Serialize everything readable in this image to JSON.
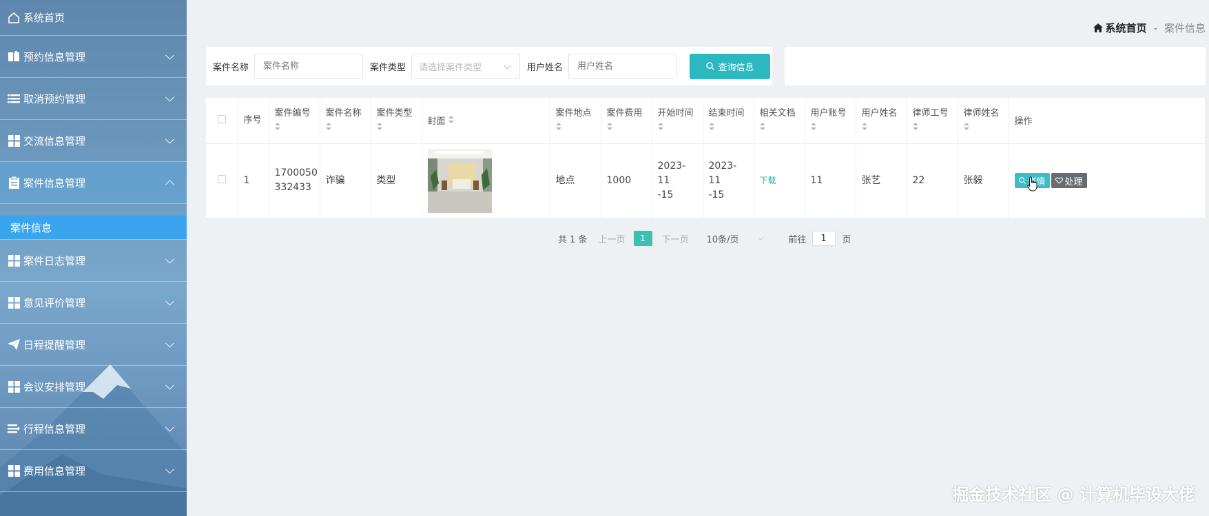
{
  "sidebar": {
    "home": "系统首页",
    "items": [
      {
        "label": "预约信息管理",
        "icon": "book-icon"
      },
      {
        "label": "取消预约管理",
        "icon": "list-icon"
      },
      {
        "label": "交流信息管理",
        "icon": "grid-icon"
      },
      {
        "label": "案件信息管理",
        "icon": "clipboard-icon",
        "expanded": true
      },
      {
        "label": "案件日志管理",
        "icon": "grid-icon"
      },
      {
        "label": "意见评价管理",
        "icon": "grid-icon"
      },
      {
        "label": "日程提醒管理",
        "icon": "paper-plane-icon"
      },
      {
        "label": "会议安排管理",
        "icon": "grid-icon"
      },
      {
        "label": "行程信息管理",
        "icon": "list-arrow-icon"
      },
      {
        "label": "费用信息管理",
        "icon": "grid-icon"
      }
    ],
    "submenu": {
      "label": "案件信息"
    },
    "accent_color": "#3aa5ee"
  },
  "breadcrumb": {
    "home": "系统首页",
    "separator": "-",
    "current": "案件信息"
  },
  "search": {
    "case_name_label": "案件名称",
    "case_name_placeholder": "案件名称",
    "case_type_label": "案件类型",
    "case_type_placeholder": "请选择案件类型",
    "user_name_label": "用户姓名",
    "user_name_placeholder": "用户姓名",
    "query_button": "查询信息",
    "button_color": "#2bb8c0"
  },
  "table": {
    "headers": {
      "index": "序号",
      "case_no": "案件编号",
      "case_name": "案件名称",
      "case_type": "案件类型",
      "cover": "封面",
      "location": "案件地点",
      "fee": "案件费用",
      "start": "开始时间",
      "end": "结束时间",
      "docs": "相关文档",
      "account": "用户账号",
      "user_name": "用户姓名",
      "lawyer_no": "律师工号",
      "lawyer_name": "律师姓名",
      "ops": "操作"
    },
    "rows": [
      {
        "index": "1",
        "case_no_1": "1700050",
        "case_no_2": "332433",
        "case_name": "诈骗",
        "case_type": "类型",
        "location": "地点",
        "fee": "1000",
        "start_1": "2023-11",
        "start_2": "-15",
        "end_1": "2023-11",
        "end_2": "-15",
        "docs": "下载",
        "account": "11",
        "user_name": "张艺",
        "lawyer_no": "22",
        "lawyer_name": "张毅",
        "detail_button": "详情",
        "handle_button": "处理"
      }
    ]
  },
  "pager": {
    "total": "共 1 条",
    "prev": "上一页",
    "current_page": "1",
    "next": "下一页",
    "page_size": "10条/页",
    "goto_label": "前往",
    "goto_value": "1",
    "page_unit": "页"
  },
  "watermark": "掘金技术社区 @ 计算机毕设大佬"
}
